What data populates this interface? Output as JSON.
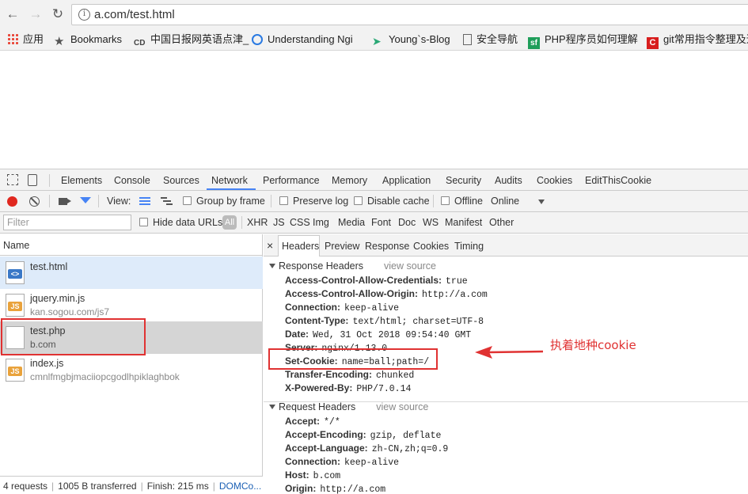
{
  "browser": {
    "url": "a.com/test.html",
    "bookmarks": [
      {
        "label": "应用",
        "icon": "apps-grid-icon"
      },
      {
        "label": "Bookmarks",
        "icon": "star-icon"
      },
      {
        "label": "中国日报网英语点津_",
        "icon": "site-icon"
      },
      {
        "label": "Understanding Ngi",
        "icon": "refresh-blue-icon"
      },
      {
        "label": "Young`s-Blog",
        "icon": "paper-plane-icon"
      },
      {
        "label": "安全导航",
        "icon": "page-icon"
      },
      {
        "label": "PHP程序员如何理解",
        "icon": "sf-icon"
      },
      {
        "label": "git常用指令整理及追",
        "icon": "c-icon"
      }
    ]
  },
  "devtools": {
    "tabs": [
      "Elements",
      "Console",
      "Sources",
      "Network",
      "Performance",
      "Memory",
      "Application",
      "Security",
      "Audits",
      "Cookies",
      "EditThisCookie"
    ],
    "active_tab": "Network",
    "toolbar": {
      "view_label": "View:",
      "group_by_frame": "Group by frame",
      "preserve_log": "Preserve log",
      "disable_cache": "Disable cache",
      "offline": "Offline",
      "throttle": "Online"
    },
    "filter": {
      "placeholder": "Filter",
      "hide_data_urls": "Hide data URLs",
      "all": "All",
      "types": [
        "XHR",
        "JS",
        "CSS",
        "Img",
        "Media",
        "Font",
        "Doc",
        "WS",
        "Manifest",
        "Other"
      ]
    },
    "requests": {
      "column_header": "Name",
      "rows": [
        {
          "name": "test.html",
          "sub": "",
          "type": "html",
          "selected": true
        },
        {
          "name": "jquery.min.js",
          "sub": "kan.sogou.com/js7",
          "type": "js",
          "selected": false
        },
        {
          "name": "test.php",
          "sub": "b.com",
          "type": "blank",
          "selected": false
        },
        {
          "name": "index.js",
          "sub": "cmnlfmgbjmaciiopcgodlhpiklaghbok",
          "type": "js",
          "selected": false
        }
      ]
    },
    "status": {
      "requests": "4 requests",
      "transferred": "1005 B transferred",
      "finish": "Finish: 215 ms",
      "dom": "DOMCo..."
    },
    "detail": {
      "close": "×",
      "tabs": [
        "Headers",
        "Preview",
        "Response",
        "Cookies",
        "Timing"
      ],
      "active_tab": "Headers",
      "response_title": "Response Headers",
      "request_title": "Request Headers",
      "view_source": "view source",
      "response_headers": [
        {
          "k": "Access-Control-Allow-Credentials:",
          "v": "true"
        },
        {
          "k": "Access-Control-Allow-Origin:",
          "v": "http://a.com"
        },
        {
          "k": "Connection:",
          "v": "keep-alive"
        },
        {
          "k": "Content-Type:",
          "v": "text/html; charset=UTF-8"
        },
        {
          "k": "Date:",
          "v": "Wed, 31 Oct 2018 09:54:40 GMT"
        },
        {
          "k": "Server:",
          "v": "nginx/1.13.0"
        },
        {
          "k": "Set-Cookie:",
          "v": "name=ball;path=/"
        },
        {
          "k": "Transfer-Encoding:",
          "v": "chunked"
        },
        {
          "k": "X-Powered-By:",
          "v": "PHP/7.0.14"
        }
      ],
      "request_headers": [
        {
          "k": "Accept:",
          "v": "*/*"
        },
        {
          "k": "Accept-Encoding:",
          "v": "gzip, deflate"
        },
        {
          "k": "Accept-Language:",
          "v": "zh-CN,zh;q=0.9"
        },
        {
          "k": "Connection:",
          "v": "keep-alive"
        },
        {
          "k": "Host:",
          "v": "b.com"
        },
        {
          "k": "Origin:",
          "v": "http://a.com"
        }
      ]
    }
  },
  "annotation": {
    "label": "执着地种cookie",
    "color": "#e03232"
  }
}
